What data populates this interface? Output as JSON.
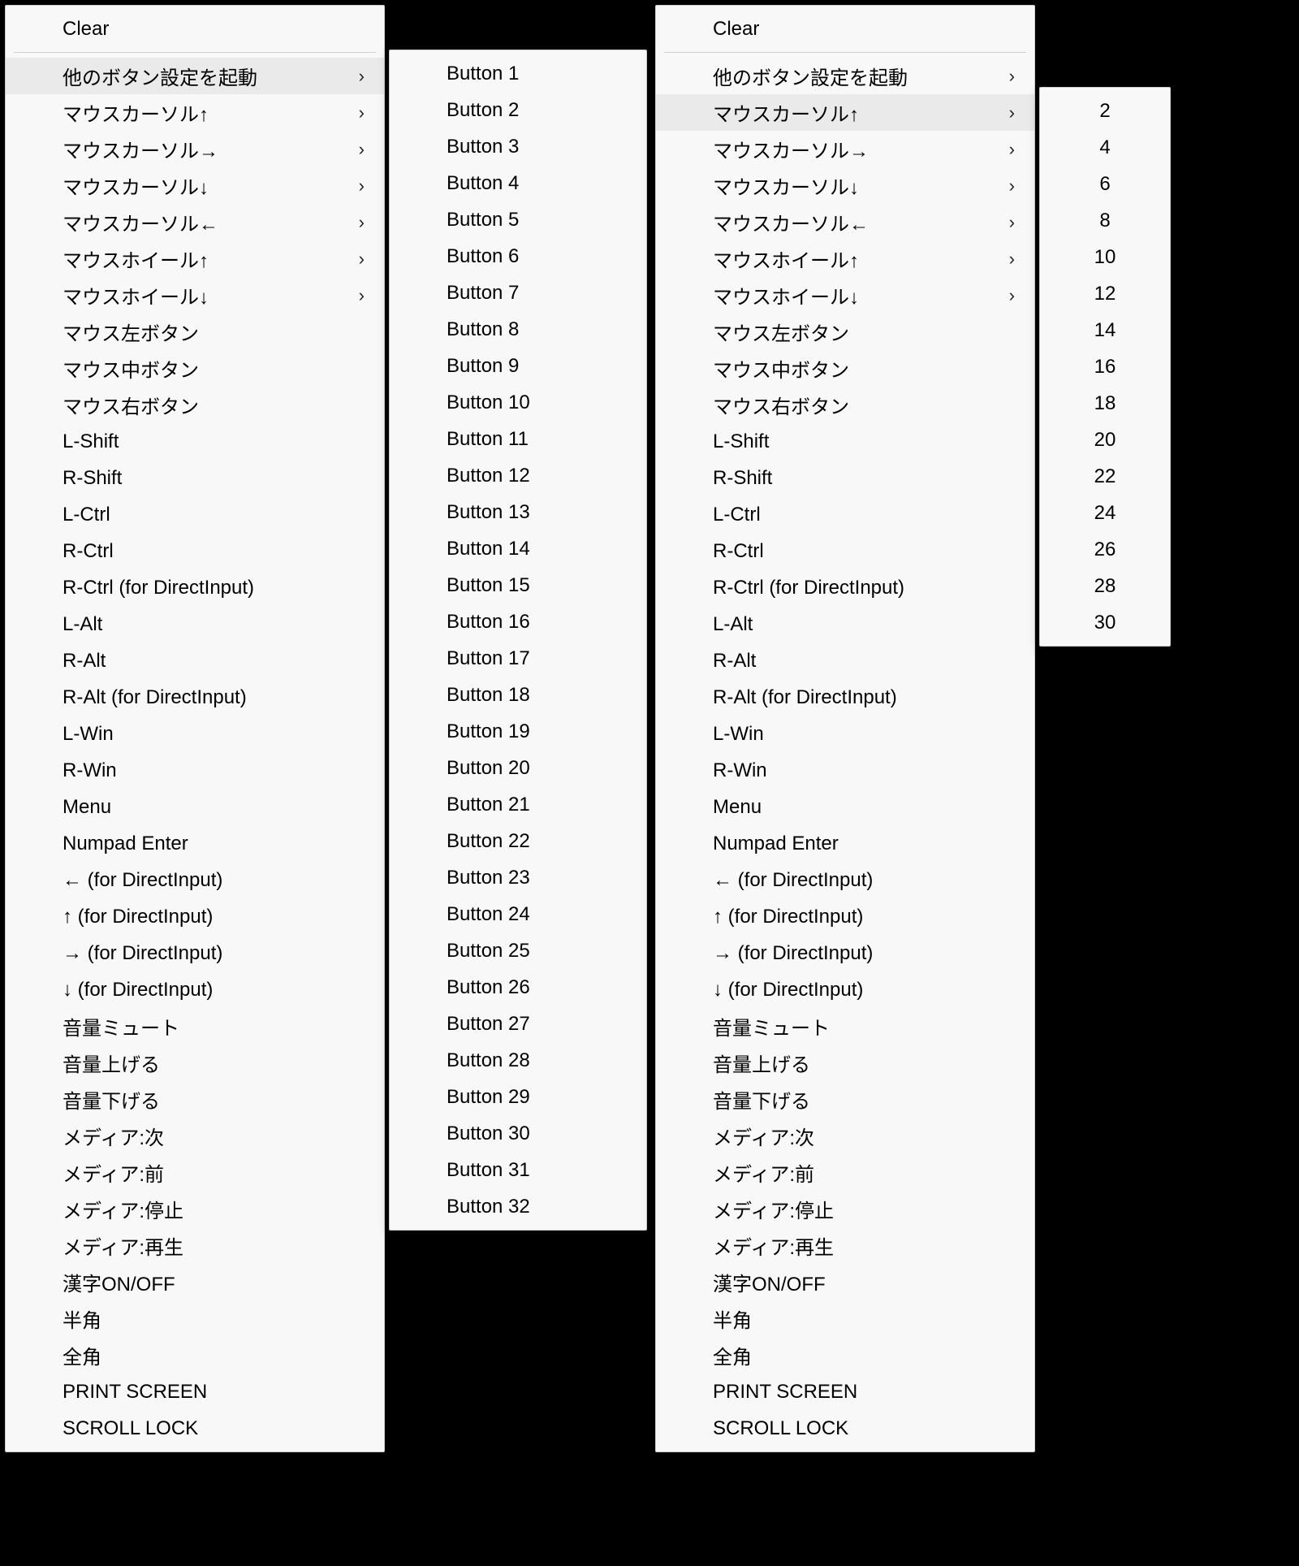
{
  "left": {
    "main": [
      {
        "label": "Clear",
        "arrow": false,
        "sep_after": true,
        "hi": false
      },
      {
        "label": "他のボタン設定を起動",
        "arrow": true,
        "sep_after": false,
        "hi": true
      },
      {
        "label": "マウスカーソル↑",
        "arrow": true,
        "sep_after": false,
        "hi": false
      },
      {
        "label": "マウスカーソル→",
        "arrow": true,
        "sep_after": false,
        "hi": false
      },
      {
        "label": "マウスカーソル↓",
        "arrow": true,
        "sep_after": false,
        "hi": false
      },
      {
        "label": "マウスカーソル←",
        "arrow": true,
        "sep_after": false,
        "hi": false
      },
      {
        "label": "マウスホイール↑",
        "arrow": true,
        "sep_after": false,
        "hi": false
      },
      {
        "label": "マウスホイール↓",
        "arrow": true,
        "sep_after": false,
        "hi": false
      },
      {
        "label": "マウス左ボタン",
        "arrow": false,
        "sep_after": false,
        "hi": false
      },
      {
        "label": "マウス中ボタン",
        "arrow": false,
        "sep_after": false,
        "hi": false
      },
      {
        "label": "マウス右ボタン",
        "arrow": false,
        "sep_after": false,
        "hi": false
      },
      {
        "label": "L-Shift",
        "arrow": false,
        "sep_after": false,
        "hi": false
      },
      {
        "label": "R-Shift",
        "arrow": false,
        "sep_after": false,
        "hi": false
      },
      {
        "label": "L-Ctrl",
        "arrow": false,
        "sep_after": false,
        "hi": false
      },
      {
        "label": "R-Ctrl",
        "arrow": false,
        "sep_after": false,
        "hi": false
      },
      {
        "label": "R-Ctrl (for DirectInput)",
        "arrow": false,
        "sep_after": false,
        "hi": false
      },
      {
        "label": "L-Alt",
        "arrow": false,
        "sep_after": false,
        "hi": false
      },
      {
        "label": "R-Alt",
        "arrow": false,
        "sep_after": false,
        "hi": false
      },
      {
        "label": "R-Alt (for DirectInput)",
        "arrow": false,
        "sep_after": false,
        "hi": false
      },
      {
        "label": "L-Win",
        "arrow": false,
        "sep_after": false,
        "hi": false
      },
      {
        "label": "R-Win",
        "arrow": false,
        "sep_after": false,
        "hi": false
      },
      {
        "label": "Menu",
        "arrow": false,
        "sep_after": false,
        "hi": false
      },
      {
        "label": "Numpad Enter",
        "arrow": false,
        "sep_after": false,
        "hi": false
      },
      {
        "label": "← (for DirectInput)",
        "arrow": false,
        "sep_after": false,
        "hi": false
      },
      {
        "label": "↑ (for DirectInput)",
        "arrow": false,
        "sep_after": false,
        "hi": false
      },
      {
        "label": "→ (for DirectInput)",
        "arrow": false,
        "sep_after": false,
        "hi": false
      },
      {
        "label": "↓ (for DirectInput)",
        "arrow": false,
        "sep_after": false,
        "hi": false
      },
      {
        "label": "音量ミュート",
        "arrow": false,
        "sep_after": false,
        "hi": false
      },
      {
        "label": "音量上げる",
        "arrow": false,
        "sep_after": false,
        "hi": false
      },
      {
        "label": "音量下げる",
        "arrow": false,
        "sep_after": false,
        "hi": false
      },
      {
        "label": "メディア:次",
        "arrow": false,
        "sep_after": false,
        "hi": false
      },
      {
        "label": "メディア:前",
        "arrow": false,
        "sep_after": false,
        "hi": false
      },
      {
        "label": "メディア:停止",
        "arrow": false,
        "sep_after": false,
        "hi": false
      },
      {
        "label": "メディア:再生",
        "arrow": false,
        "sep_after": false,
        "hi": false
      },
      {
        "label": "漢字ON/OFF",
        "arrow": false,
        "sep_after": false,
        "hi": false
      },
      {
        "label": "半角",
        "arrow": false,
        "sep_after": false,
        "hi": false
      },
      {
        "label": "全角",
        "arrow": false,
        "sep_after": false,
        "hi": false
      },
      {
        "label": "PRINT SCREEN",
        "arrow": false,
        "sep_after": false,
        "hi": false
      },
      {
        "label": "SCROLL LOCK",
        "arrow": false,
        "sep_after": false,
        "hi": false
      }
    ],
    "sub": [
      "Button 1",
      "Button 2",
      "Button 3",
      "Button 4",
      "Button 5",
      "Button 6",
      "Button 7",
      "Button 8",
      "Button 9",
      "Button 10",
      "Button 11",
      "Button 12",
      "Button 13",
      "Button 14",
      "Button 15",
      "Button 16",
      "Button 17",
      "Button 18",
      "Button 19",
      "Button 20",
      "Button 21",
      "Button 22",
      "Button 23",
      "Button 24",
      "Button 25",
      "Button 26",
      "Button 27",
      "Button 28",
      "Button 29",
      "Button 30",
      "Button 31",
      "Button 32"
    ]
  },
  "right": {
    "main": [
      {
        "label": "Clear",
        "arrow": false,
        "sep_after": true,
        "hi": false
      },
      {
        "label": "他のボタン設定を起動",
        "arrow": true,
        "sep_after": false,
        "hi": false
      },
      {
        "label": "マウスカーソル↑",
        "arrow": true,
        "sep_after": false,
        "hi": true
      },
      {
        "label": "マウスカーソル→",
        "arrow": true,
        "sep_after": false,
        "hi": false
      },
      {
        "label": "マウスカーソル↓",
        "arrow": true,
        "sep_after": false,
        "hi": false
      },
      {
        "label": "マウスカーソル←",
        "arrow": true,
        "sep_after": false,
        "hi": false
      },
      {
        "label": "マウスホイール↑",
        "arrow": true,
        "sep_after": false,
        "hi": false
      },
      {
        "label": "マウスホイール↓",
        "arrow": true,
        "sep_after": false,
        "hi": false
      },
      {
        "label": "マウス左ボタン",
        "arrow": false,
        "sep_after": false,
        "hi": false
      },
      {
        "label": "マウス中ボタン",
        "arrow": false,
        "sep_after": false,
        "hi": false
      },
      {
        "label": "マウス右ボタン",
        "arrow": false,
        "sep_after": false,
        "hi": false
      },
      {
        "label": "L-Shift",
        "arrow": false,
        "sep_after": false,
        "hi": false
      },
      {
        "label": "R-Shift",
        "arrow": false,
        "sep_after": false,
        "hi": false
      },
      {
        "label": "L-Ctrl",
        "arrow": false,
        "sep_after": false,
        "hi": false
      },
      {
        "label": "R-Ctrl",
        "arrow": false,
        "sep_after": false,
        "hi": false
      },
      {
        "label": "R-Ctrl (for DirectInput)",
        "arrow": false,
        "sep_after": false,
        "hi": false
      },
      {
        "label": "L-Alt",
        "arrow": false,
        "sep_after": false,
        "hi": false
      },
      {
        "label": "R-Alt",
        "arrow": false,
        "sep_after": false,
        "hi": false
      },
      {
        "label": "R-Alt (for DirectInput)",
        "arrow": false,
        "sep_after": false,
        "hi": false
      },
      {
        "label": "L-Win",
        "arrow": false,
        "sep_after": false,
        "hi": false
      },
      {
        "label": "R-Win",
        "arrow": false,
        "sep_after": false,
        "hi": false
      },
      {
        "label": "Menu",
        "arrow": false,
        "sep_after": false,
        "hi": false
      },
      {
        "label": "Numpad Enter",
        "arrow": false,
        "sep_after": false,
        "hi": false
      },
      {
        "label": "← (for DirectInput)",
        "arrow": false,
        "sep_after": false,
        "hi": false
      },
      {
        "label": "↑ (for DirectInput)",
        "arrow": false,
        "sep_after": false,
        "hi": false
      },
      {
        "label": "→ (for DirectInput)",
        "arrow": false,
        "sep_after": false,
        "hi": false
      },
      {
        "label": "↓ (for DirectInput)",
        "arrow": false,
        "sep_after": false,
        "hi": false
      },
      {
        "label": "音量ミュート",
        "arrow": false,
        "sep_after": false,
        "hi": false
      },
      {
        "label": "音量上げる",
        "arrow": false,
        "sep_after": false,
        "hi": false
      },
      {
        "label": "音量下げる",
        "arrow": false,
        "sep_after": false,
        "hi": false
      },
      {
        "label": "メディア:次",
        "arrow": false,
        "sep_after": false,
        "hi": false
      },
      {
        "label": "メディア:前",
        "arrow": false,
        "sep_after": false,
        "hi": false
      },
      {
        "label": "メディア:停止",
        "arrow": false,
        "sep_after": false,
        "hi": false
      },
      {
        "label": "メディア:再生",
        "arrow": false,
        "sep_after": false,
        "hi": false
      },
      {
        "label": "漢字ON/OFF",
        "arrow": false,
        "sep_after": false,
        "hi": false
      },
      {
        "label": "半角",
        "arrow": false,
        "sep_after": false,
        "hi": false
      },
      {
        "label": "全角",
        "arrow": false,
        "sep_after": false,
        "hi": false
      },
      {
        "label": "PRINT SCREEN",
        "arrow": false,
        "sep_after": false,
        "hi": false
      },
      {
        "label": "SCROLL LOCK",
        "arrow": false,
        "sep_after": false,
        "hi": false
      }
    ],
    "sub": [
      "2",
      "4",
      "6",
      "8",
      "10",
      "12",
      "14",
      "16",
      "18",
      "20",
      "22",
      "24",
      "26",
      "28",
      "30"
    ]
  }
}
